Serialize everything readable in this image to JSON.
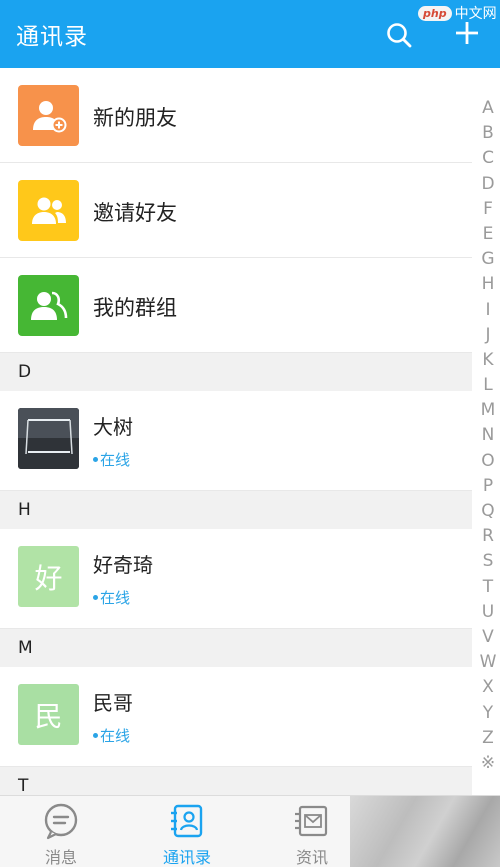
{
  "header": {
    "title": "通讯录",
    "search_icon": "search-icon",
    "add_icon": "plus-icon"
  },
  "watermark": {
    "logo": "php",
    "text": "中文网"
  },
  "top_items": [
    {
      "label": "新的朋友",
      "icon": "add-friend-icon",
      "color": "#f7924b"
    },
    {
      "label": "邀请好友",
      "icon": "group-people-icon",
      "color": "#ffc81a"
    },
    {
      "label": "我的群组",
      "icon": "group-icon",
      "color": "#46b734"
    }
  ],
  "sections": [
    {
      "letter": "D",
      "contacts": [
        {
          "name": "大树",
          "status": "在线",
          "avatar_type": "photo"
        }
      ]
    },
    {
      "letter": "H",
      "contacts": [
        {
          "name": "好奇琦",
          "status": "在线",
          "avatar_char": "好",
          "avatar_color": "#b1e3a6"
        }
      ]
    },
    {
      "letter": "M",
      "contacts": [
        {
          "name": "民哥",
          "status": "在线",
          "avatar_char": "民",
          "avatar_color": "#a9dfa3"
        }
      ]
    },
    {
      "letter": "T",
      "contacts": []
    }
  ],
  "alphabet": [
    "A",
    "B",
    "C",
    "D",
    "F",
    "E",
    "G",
    "H",
    "I",
    "J",
    "K",
    "L",
    "M",
    "N",
    "O",
    "P",
    "Q",
    "R",
    "S",
    "T",
    "U",
    "V",
    "W",
    "X",
    "Y",
    "Z",
    "※"
  ],
  "bottom_nav": [
    {
      "label": "消息",
      "icon": "message-bubble-icon",
      "active": false
    },
    {
      "label": "通讯录",
      "icon": "contacts-icon",
      "active": true
    },
    {
      "label": "资讯",
      "icon": "news-icon",
      "active": false
    }
  ],
  "colors": {
    "accent": "#1aa3f0",
    "status": "#2ba4e6"
  }
}
